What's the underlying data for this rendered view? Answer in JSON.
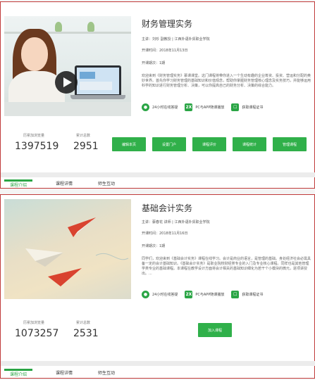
{
  "course1": {
    "title": "财务管理实务",
    "speaker": "主讲：刘珍 副教授 | 江西外语外贸职业学院",
    "open_time": "开课时间：2018年11月13日",
    "open_round": "开课期次：1期",
    "description": "欢迎来到《财务管理实务》慕课课堂。这门课程将带你进入一个生动有趣的企业筹资、投资、营运和分配的奥妙世界。首先你学习财务管理的基础知识和价值观念，帮助你掌握财务管理核心理念及实务技巧，并能够运用科学的知识进行财务管理分析、决策，可以你提高自己的财务分析、决策的综合能力。",
    "features": [
      "24小时在线答疑",
      "PC与APP随课播放",
      "获取课程证书"
    ],
    "feature_icons": [
      "chat-icon",
      "2x",
      "certificate-icon"
    ],
    "stats": [
      {
        "label": "历累加浏览量",
        "value": "1397519"
      },
      {
        "label": "累计总数",
        "value": "2951"
      }
    ],
    "buttons": [
      "编辑本页",
      "设置门户",
      "课程评价",
      "课程统计",
      "管理课程"
    ],
    "tabs": [
      "课程介绍",
      "课程详情",
      "师生互动"
    ]
  },
  "course2": {
    "title": "基础会计实务",
    "speaker": "主讲：蔡春花 讲师 | 江西外语外贸职业学院",
    "open_time": "开课时间：2018年11月16日",
    "open_round": "开课期次：1期",
    "description": "同学们，欢迎来到《基础会计实务》课程在线学习。会计是商业的语言，是管理的基础。身处经济社会必需具备一定的会计基础知识。《基础会计实务》是职业院校财经类专业的入门及专业核心课程。同样也是其他管理学类专业的基础课程。本课程在教学设计方面将会计相关的基础知识细化为若干个小模块的微元，逐项讲授出。...",
    "features": [
      "24小时在线答疑",
      "PC与APP随课播放",
      "获取课程证书"
    ],
    "feature_icons": [
      "chat-icon",
      "2x",
      "certificate-icon"
    ],
    "stats": [
      {
        "label": "历累加浏览量",
        "value": "1073257"
      },
      {
        "label": "累计总数",
        "value": "2531"
      }
    ],
    "buttons": [
      "加入课程"
    ],
    "tabs": [
      "课程介绍",
      "课程详情",
      "师生互动"
    ]
  }
}
